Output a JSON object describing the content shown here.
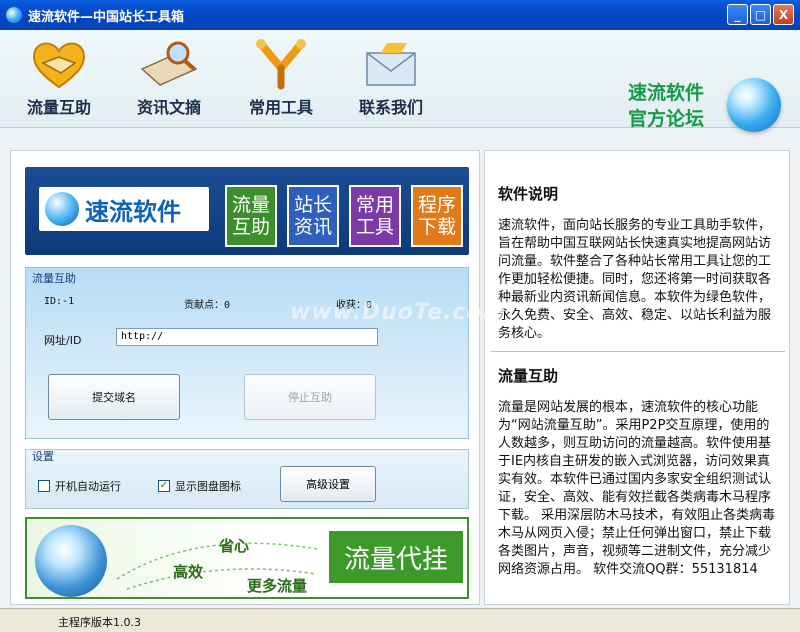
{
  "window": {
    "title": "速流软件—中国站长工具箱",
    "minimize": "_",
    "maximize": "□",
    "close": "X"
  },
  "toolbar": {
    "items": [
      {
        "label": "流量互助",
        "icon": "handshake-icon"
      },
      {
        "label": "资讯文摘",
        "icon": "keyboard-search-icon"
      },
      {
        "label": "常用工具",
        "icon": "tools-icon"
      },
      {
        "label": "联系我们",
        "icon": "mail-icon"
      }
    ],
    "forum_line1": "速流软件",
    "forum_line2": "官方论坛"
  },
  "banner": {
    "logo_text": "速流软件",
    "tiles": [
      {
        "line1": "流量",
        "line2": "互助"
      },
      {
        "line1": "站长",
        "line2": "资讯"
      },
      {
        "line1": "常用",
        "line2": "工具"
      },
      {
        "line1": "程序",
        "line2": "下载"
      }
    ]
  },
  "traffic": {
    "title": "流量互助",
    "id_label": "ID:-1",
    "points_label": "贡献点：0",
    "income_label": "收获：0",
    "url_label": "网址/ID",
    "url_value": "http://",
    "submit_label": "提交域名",
    "stop_label": "停止互助"
  },
  "settings": {
    "title": "设置",
    "autorun_label": "开机自动运行",
    "autorun_checked": false,
    "tray_label": "显示图盘图标",
    "tray_checked": true,
    "advanced_label": "高级设置"
  },
  "ad": {
    "w1": "省心",
    "w2": "高效",
    "w3": "更多流量",
    "cta": "流量代挂"
  },
  "info": {
    "h1": "软件说明",
    "p1": "速流软件，面向站长服务的专业工具助手软件，旨在帮助中国互联网站长快速真实地提高网站访问流量。软件整合了各种站长常用工具让您的工作更加轻松便捷。同时，您还将第一时间获取各种最新业内资讯新闻信息。本软件为绿色软件，永久免费、安全、高效、稳定、以站长利益为服务核心。",
    "h2": "流量互助",
    "p2": "流量是网站发展的根本，速流软件的核心功能为“网站流量互助”。采用P2P交互原理，使用的人数越多，则互助访问的流量越高。软件使用基于IE内核自主研发的嵌入式浏览器，访问效果真实有效。本软件已通过国内多家安全组织测试认证，安全、高效、能有效拦截各类病毒木马程序下载。 采用深层防木马技术，有效阻止各类病毒木马从网页入侵；禁止任何弹出窗口，禁止下载各类图片，声音，视频等二进制文件，充分减少网络资源占用。 软件交流QQ群：55131814"
  },
  "status": {
    "version": "主程序版本1.0.3"
  },
  "watermark": "www.DuoTe.com"
}
